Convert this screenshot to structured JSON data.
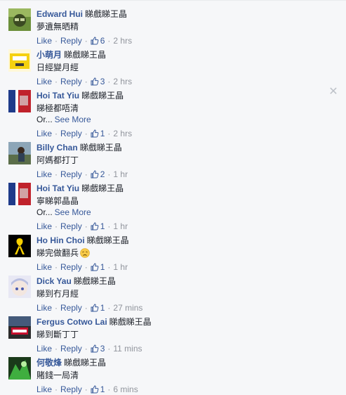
{
  "actions": {
    "like_label": "Like",
    "reply_label": "Reply"
  },
  "colors": {
    "link": "#365899",
    "meta": "#90949c",
    "text": "#1d2129",
    "background": "#f6f7f9"
  },
  "comments": [
    {
      "author": "Edward Hui",
      "tag": "睇戲睇王晶",
      "text": "夢遺無晒精",
      "more": "",
      "likes": "6",
      "time": "2 hrs",
      "avatar": "green-glasses-avatar"
    },
    {
      "author": "小萌月",
      "tag": "睇戲睇王晶",
      "text": "日經變月經",
      "more": "",
      "likes": "3",
      "time": "2 hrs",
      "avatar": "yellow-cartoon-avatar"
    },
    {
      "author": "Hoi Tat Yiu",
      "tag": "睇戲睇王晶",
      "text": "睇極都唔清",
      "more": "Or...",
      "see_more": "See More",
      "likes": "1",
      "time": "2 hrs",
      "avatar": "flag-avatar"
    },
    {
      "author": "Billy Chan",
      "tag": "睇戲睇王晶",
      "text": "阿媽都打丁",
      "more": "",
      "likes": "2",
      "time": "1 hr",
      "avatar": "photo-avatar"
    },
    {
      "author": "Hoi Tat Yiu",
      "tag": "睇戲睇王晶",
      "text": "寧睇郭晶晶",
      "more": "Or...",
      "see_more": "See More",
      "likes": "1",
      "time": "1 hr",
      "avatar": "flag-avatar"
    },
    {
      "author": "Ho Hin Choi",
      "tag": "睇戲睇王晶",
      "text": "睇完做翻兵",
      "more": "",
      "likes": "1",
      "time": "1 hr",
      "avatar": "yellow-ribbon-avatar",
      "emoji": "disappointed-emoji"
    },
    {
      "author": "Dick Yau",
      "tag": "睇戲睇王晶",
      "text": "睇到冇月經",
      "more": "",
      "likes": "1",
      "time": "27 mins",
      "avatar": "anime-avatar"
    },
    {
      "author": "Fergus Cotwo Lai",
      "tag": "睇戲睇王晶",
      "text": "睇到斷丁丁",
      "more": "",
      "likes": "3",
      "time": "11 mins",
      "avatar": "arsenal-avatar"
    },
    {
      "author": "何敬烽",
      "tag": "睇戲睇王晶",
      "text": "賭錢一局清",
      "more": "",
      "likes": "1",
      "time": "6 mins",
      "avatar": "green-fantasy-avatar"
    }
  ]
}
